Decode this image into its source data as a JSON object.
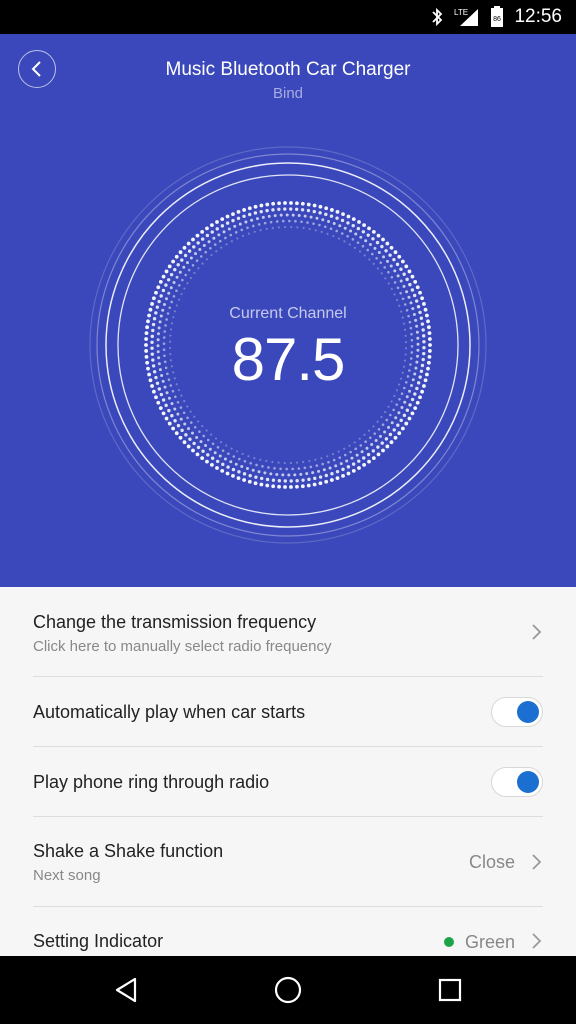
{
  "status_bar": {
    "time": "12:56",
    "network": "LTE",
    "battery": "86",
    "icons": [
      "bluetooth-icon",
      "signal-icon",
      "battery-icon"
    ]
  },
  "header": {
    "title": "Music Bluetooth Car Charger",
    "subtitle": "Bind",
    "back_icon": "chevron-left-icon"
  },
  "dial": {
    "label": "Current Channel",
    "value": "87.5"
  },
  "settings": {
    "frequency": {
      "title": "Change the transmission frequency",
      "subtitle": "Click here to manually select radio frequency"
    },
    "auto_play": {
      "title": "Automatically play when car starts",
      "enabled": true
    },
    "ring": {
      "title": "Play phone ring through radio",
      "enabled": true
    },
    "shake": {
      "title": "Shake a Shake function",
      "subtitle": "Next song",
      "value": "Close"
    },
    "indicator": {
      "title": "Setting Indicator",
      "value": "Green",
      "color": "#1ea448"
    }
  },
  "colors": {
    "hero_bg": "#3a48bb",
    "toggle_on": "#1a6fd0"
  },
  "nav_bar": {
    "icons": [
      "back-triangle-icon",
      "home-circle-icon",
      "recents-square-icon"
    ]
  }
}
